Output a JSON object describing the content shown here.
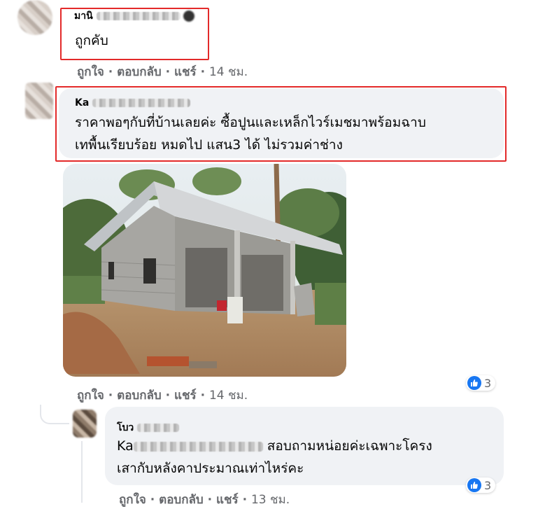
{
  "comments": [
    {
      "name_prefix": "มานิ",
      "text": "ถูกคับ",
      "actions": {
        "like": "ถูกใจ",
        "reply": "ตอบกลับ",
        "share": "แชร์",
        "time": "14 ชม."
      }
    },
    {
      "name_prefix": "Ka",
      "text_line1": "ราคาพอๆกับที่บ้านเลยค่ะ ซื้อปูนและเหล็กไวร์เมชมาพร้อมฉาบ",
      "text_line2": "เทพื้นเรียบร้อย หมดไป แสน3 ได้ ไม่รวมค่าช่าง",
      "actions": {
        "like": "ถูกใจ",
        "reply": "ตอบกลับ",
        "share": "แชร์",
        "time": "14 ชม."
      },
      "reaction_count": "3"
    },
    {
      "name_prefix": "โบว",
      "text_line1_prefix": "Ka",
      "text_line1": "สอบถามหน่อยค่ะเฉพาะโครง",
      "text_line2": "เสากับหลังคาประมาณเท่าไหร่คะ",
      "actions": {
        "like": "ถูกใจ",
        "reply": "ตอบกลับ",
        "share": "แชร์",
        "time": "13 ชม."
      },
      "reaction_count": "3"
    }
  ],
  "separator": "·",
  "colors": {
    "bubble": "#f0f2f5",
    "highlight": "#e32a2a",
    "like": "#1877f2",
    "meta": "#65676b"
  }
}
